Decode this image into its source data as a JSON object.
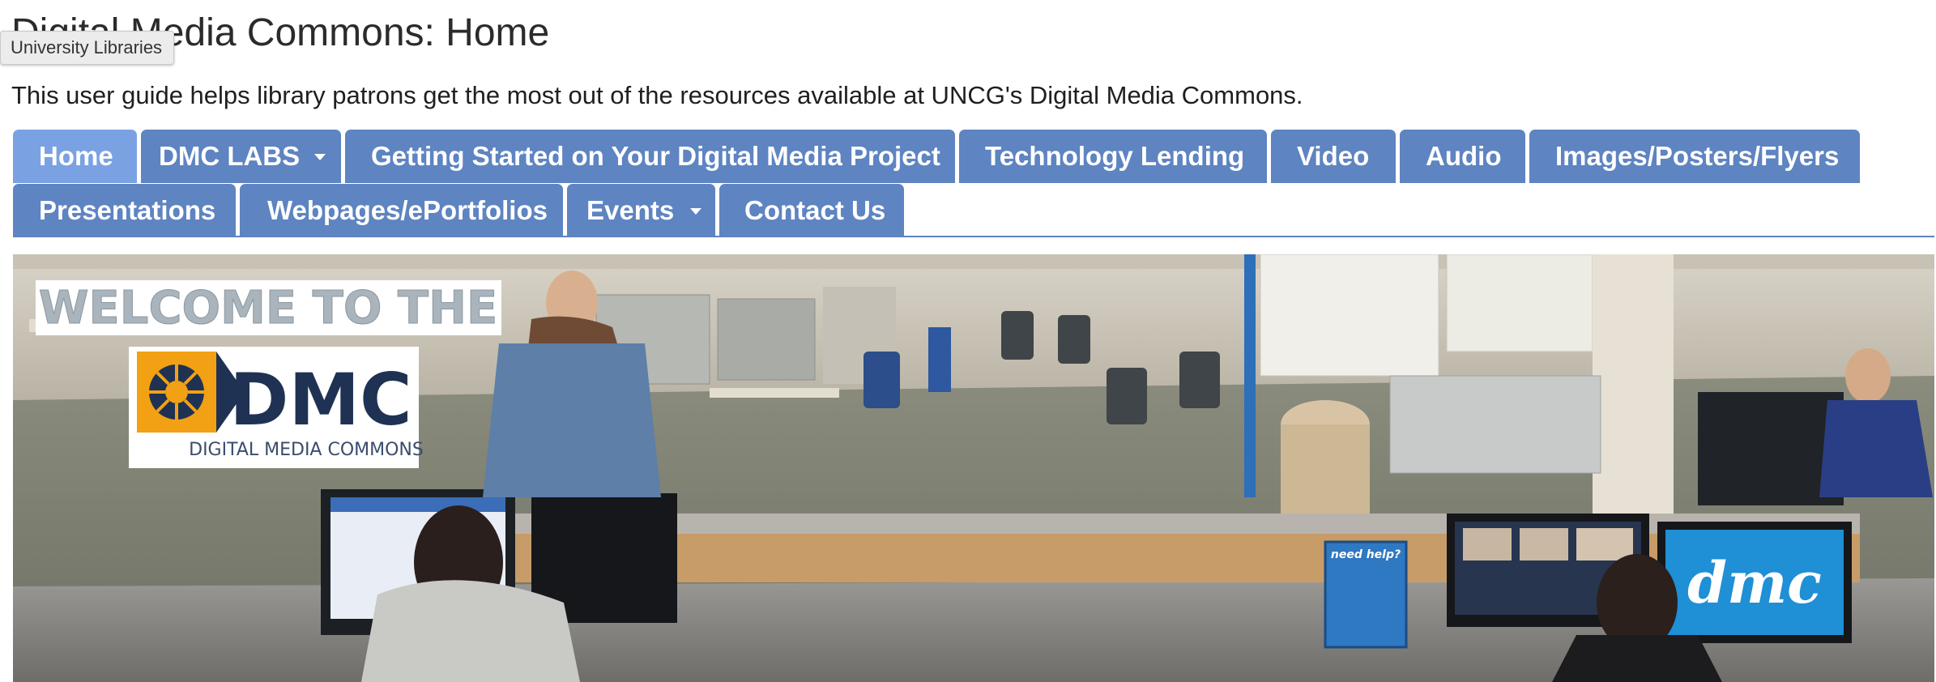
{
  "page": {
    "title": "Digital Media Commons: Home",
    "tooltip": "University Libraries",
    "description": "This user guide helps library patrons get the most out of the resources available at UNCG's Digital Media Commons."
  },
  "nav": {
    "tabs": [
      {
        "label": "Home",
        "active": true,
        "dropdown": false
      },
      {
        "label": "DMC LABS",
        "active": false,
        "dropdown": true
      },
      {
        "label": "Getting Started on Your Digital Media Project",
        "active": false,
        "dropdown": false
      },
      {
        "label": "Technology Lending",
        "active": false,
        "dropdown": false
      },
      {
        "label": "Video",
        "active": false,
        "dropdown": false
      },
      {
        "label": "Audio",
        "active": false,
        "dropdown": false
      },
      {
        "label": "Images/Posters/Flyers",
        "active": false,
        "dropdown": false
      },
      {
        "label": "Presentations",
        "active": false,
        "dropdown": false
      },
      {
        "label": "Webpages/ePortfolios",
        "active": false,
        "dropdown": false
      },
      {
        "label": "Events",
        "active": false,
        "dropdown": true
      },
      {
        "label": "Contact Us",
        "active": false,
        "dropdown": false
      }
    ]
  },
  "banner": {
    "welcome_text": "WELCOME TO THE",
    "logo_text": "DMC",
    "logo_subtext": "DIGITAL MEDIA COMMONS",
    "sign_text": "need help?",
    "screen_text": "dmc"
  },
  "colors": {
    "tab": "#5e84c1",
    "tab_active": "#7aa2e3",
    "logo_orange": "#f2a114",
    "logo_navy": "#1f3253"
  }
}
